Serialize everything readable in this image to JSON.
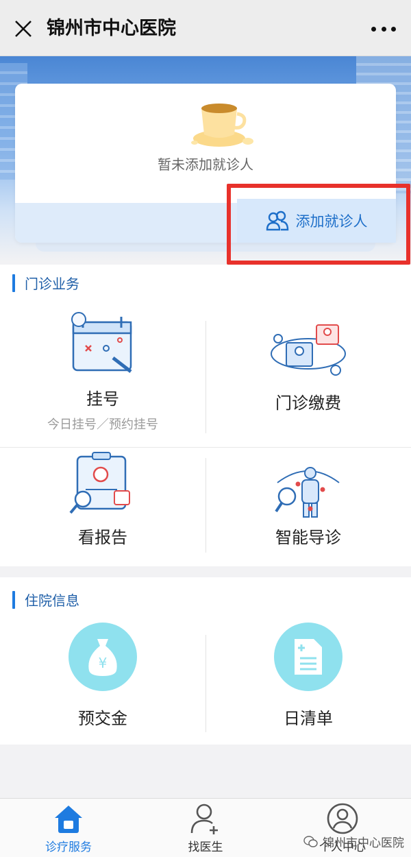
{
  "window": {
    "title": "锦州市中心医院"
  },
  "patient_card": {
    "empty_text": "暂未添加就诊人",
    "add_label": "添加就诊人"
  },
  "outpatient": {
    "section_title": "门诊业务",
    "tiles": [
      {
        "label": "挂号",
        "sub": "今日挂号／预约挂号"
      },
      {
        "label": "门诊缴费"
      },
      {
        "label": "看报告"
      },
      {
        "label": "智能导诊"
      }
    ]
  },
  "inpatient": {
    "section_title": "住院信息",
    "tiles": [
      {
        "label": "预交金"
      },
      {
        "label": "日清单"
      }
    ]
  },
  "tabbar": {
    "tabs": [
      {
        "label": "诊疗服务",
        "active": true
      },
      {
        "label": "找医生"
      },
      {
        "label": "个人中心"
      }
    ]
  },
  "watermark": {
    "text": "锦州市中心医院"
  },
  "colors": {
    "accent": "#1e7be0",
    "highlight": "#e8312b",
    "circle": "#8fe1ee"
  }
}
